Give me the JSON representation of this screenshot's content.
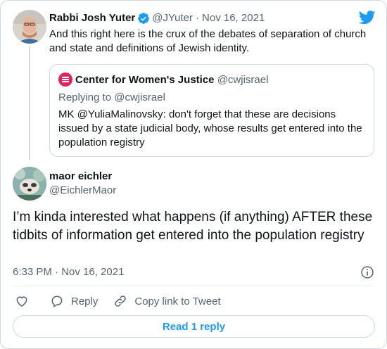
{
  "parent": {
    "name": "Rabbi Josh Yuter",
    "handle": "@JYuter",
    "separator": "·",
    "date": "Nov 16, 2021",
    "text": "And this right here is the crux of the debates of separation of church and state and definitions of Jewish identity."
  },
  "quote": {
    "name": "Center for Women's Justice",
    "handle": "@cwjisrael",
    "replying": "Replying to @cwjisrael",
    "text": "MK @YuliaMalinovsky: don't forget that these are decisions issued by a state judicial body, whose results get entered into the population registry"
  },
  "tweet": {
    "name": "maor eichler",
    "handle": "@EichlerMaor",
    "text": "I’m kinda interested what happens (if anything) AFTER these tidbits of information get entered into the population registry",
    "timestamp": "6:33 PM · Nov 16, 2021"
  },
  "actions": {
    "reply_label": "Reply",
    "copy_label": "Copy link to Tweet"
  },
  "read_replies": "Read 1 reply",
  "colors": {
    "twitter_blue": "#1d9bf0",
    "text": "#0f1419",
    "secondary": "#536471",
    "border": "#cfd9de",
    "cwj_red": "#e0245e"
  }
}
